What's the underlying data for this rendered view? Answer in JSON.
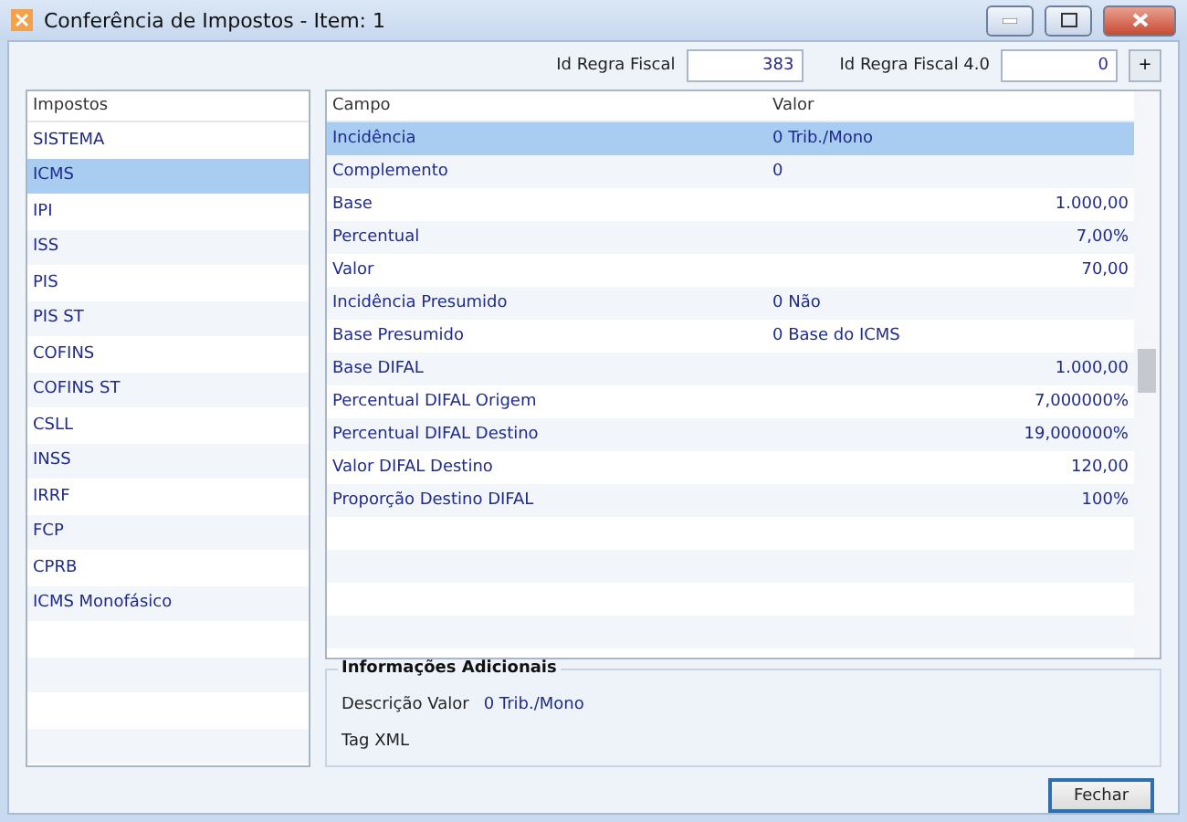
{
  "window": {
    "title": "Conferência de Impostos - Item: 1"
  },
  "header_fields": [
    {
      "label": "Id Regra Fiscal",
      "value": "383"
    },
    {
      "label": "Id Regra Fiscal 4.0",
      "value": "0"
    }
  ],
  "add_button": "+",
  "taxes": {
    "heading": "Impostos",
    "items": [
      {
        "label": "SISTEMA",
        "selected": false
      },
      {
        "label": "ICMS",
        "selected": true
      },
      {
        "label": "IPI",
        "selected": false
      },
      {
        "label": "ISS",
        "selected": false
      },
      {
        "label": "PIS",
        "selected": false
      },
      {
        "label": "PIS ST",
        "selected": false
      },
      {
        "label": "COFINS",
        "selected": false
      },
      {
        "label": "COFINS ST",
        "selected": false
      },
      {
        "label": "CSLL",
        "selected": false
      },
      {
        "label": "INSS",
        "selected": false
      },
      {
        "label": "IRRF",
        "selected": false
      },
      {
        "label": "FCP",
        "selected": false
      },
      {
        "label": "CPRB",
        "selected": false
      },
      {
        "label": "ICMS Monofásico",
        "selected": false
      }
    ]
  },
  "table": {
    "columns": [
      "Campo",
      "Valor"
    ],
    "rows": [
      {
        "campo": "Incidência",
        "valor": "0 Trib./Mono",
        "kind": "text",
        "selected": true
      },
      {
        "campo": "Complemento",
        "valor": "0",
        "kind": "text",
        "selected": false
      },
      {
        "campo": "Base",
        "valor": "1.000,00",
        "kind": "number",
        "selected": false
      },
      {
        "campo": "Percentual",
        "valor": "7,00%",
        "kind": "number",
        "selected": false
      },
      {
        "campo": "Valor",
        "valor": "70,00",
        "kind": "number",
        "selected": false
      },
      {
        "campo": "Incidência Presumido",
        "valor": "0 Não",
        "kind": "text",
        "selected": false
      },
      {
        "campo": "Base Presumido",
        "valor": "0 Base do ICMS",
        "kind": "text",
        "selected": false
      },
      {
        "campo": "Base DIFAL",
        "valor": "1.000,00",
        "kind": "number",
        "selected": false
      },
      {
        "campo": "Percentual DIFAL Origem",
        "valor": "7,000000%",
        "kind": "number",
        "selected": false
      },
      {
        "campo": "Percentual DIFAL Destino",
        "valor": "19,000000%",
        "kind": "number",
        "selected": false
      },
      {
        "campo": "Valor DIFAL Destino",
        "valor": "120,00",
        "kind": "number",
        "selected": false
      },
      {
        "campo": "Proporção Destino DIFAL",
        "valor": "100%",
        "kind": "number",
        "selected": false
      }
    ]
  },
  "additional_info": {
    "title": "Informações Adicionais",
    "fields": [
      {
        "label": "Descrição Valor",
        "value": "0 Trib./Mono"
      },
      {
        "label": "Tag XML"
      }
    ]
  },
  "close_button": "Fechar"
}
